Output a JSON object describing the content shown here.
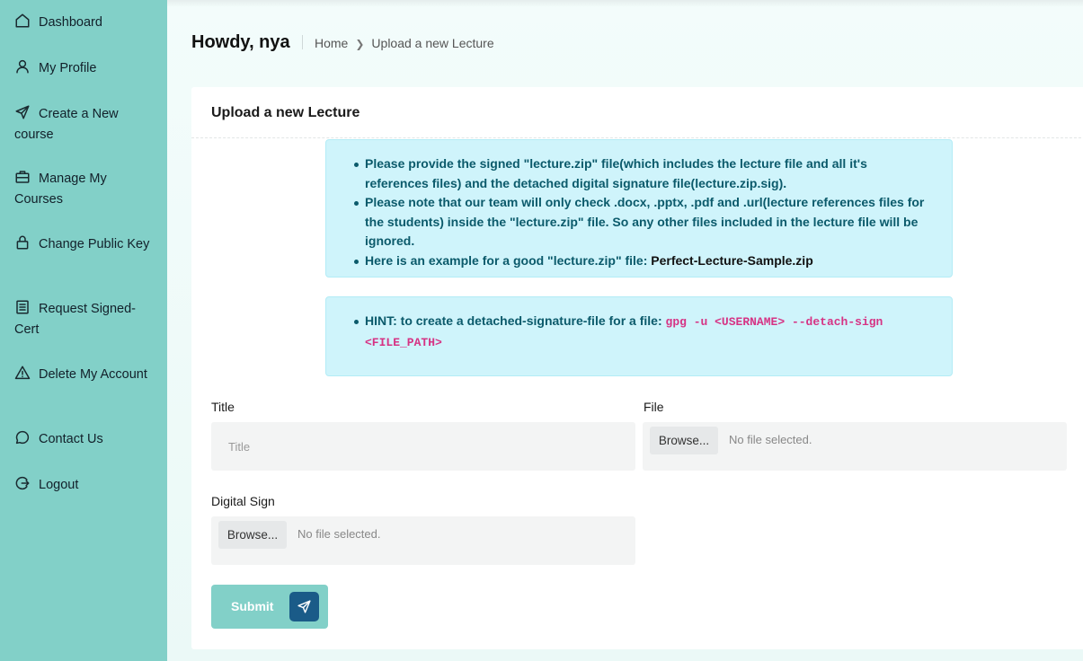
{
  "sidebar": {
    "items": [
      {
        "label": "Dashboard",
        "icon": "home-icon"
      },
      {
        "label": "My Profile",
        "icon": "user-icon"
      },
      {
        "label": "Create a New course",
        "icon": "send-icon"
      },
      {
        "label": "Manage My Courses",
        "icon": "briefcase-icon"
      },
      {
        "label": "Change Public Key",
        "icon": "lock-icon"
      },
      {
        "label": "Request Signed-Cert",
        "icon": "document-icon"
      },
      {
        "label": "Delete My Account",
        "icon": "warning-icon"
      },
      {
        "label": "Contact Us",
        "icon": "chat-icon"
      },
      {
        "label": "Logout",
        "icon": "logout-icon"
      }
    ]
  },
  "header": {
    "greeting": "Howdy, nya",
    "breadcrumb": {
      "home": "Home",
      "current": "Upload a new Lecture"
    }
  },
  "card": {
    "title": "Upload a new Lecture",
    "info": {
      "item1": "Please provide the signed \"lecture.zip\" file(which includes the lecture file and all it's references files) and the detached digital signature file(lecture.zip.sig).",
      "item2": "Please note that our team will only check .docx, .pptx, .pdf and .url(lecture references files for the students) inside the \"lecture.zip\" file. So any other files included in the lecture file will be ignored.",
      "item3_prefix": "Here is an example for a good \"lecture.zip\" file: ",
      "item3_link": "Perfect-Lecture-Sample.zip"
    },
    "hint": {
      "prefix": "HINT: to create a detached-signature-file for a file: ",
      "command": "gpg -u <USERNAME> --detach-sign <FILE_PATH>"
    },
    "form": {
      "title_label": "Title",
      "title_placeholder": "Title",
      "title_value": "",
      "file_label": "File",
      "file_button": "Browse...",
      "file_status": "No file selected.",
      "sign_label": "Digital Sign",
      "sign_button": "Browse...",
      "sign_status": "No file selected.",
      "submit_label": "Submit"
    }
  },
  "colors": {
    "sidebar_bg": "#82d0c8",
    "alert_bg": "#cff4fb",
    "alert_text": "#0b5a6b",
    "code": "#d63384",
    "submit_icon_bg": "#1a5b88"
  }
}
